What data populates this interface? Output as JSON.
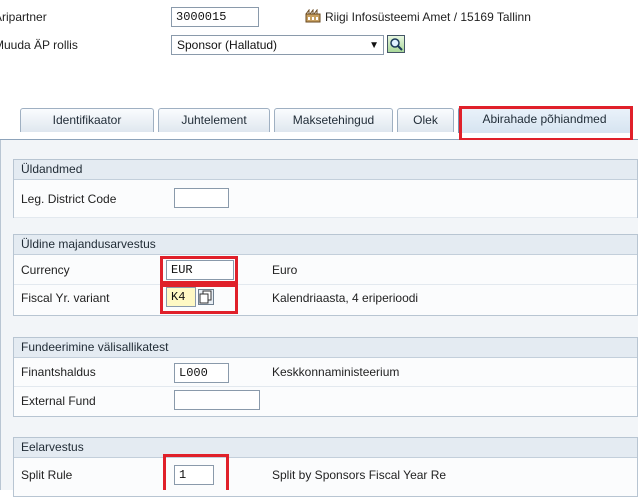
{
  "header": {
    "partner_label": "Äripartner",
    "partner_value": "3000015",
    "partner_description": "Riigi Infosüsteemi Amet / 15169 Tallinn",
    "role_label": "Muuda ÄP rollis",
    "role_value": "Sponsor (Hallatud)"
  },
  "tabs": [
    {
      "label": "Identifikaator"
    },
    {
      "label": "Juhtelement"
    },
    {
      "label": "Maksetehingud"
    },
    {
      "label": "Olek"
    },
    {
      "label": "Abirahade põhiandmed"
    }
  ],
  "sections": {
    "general": {
      "title": "Üldandmed",
      "district_label": "Leg. District Code",
      "district_value": ""
    },
    "finance": {
      "title": "Üldine majandusarvestus",
      "currency_label": "Currency",
      "currency_value": "EUR",
      "currency_text": "Euro",
      "fiscal_label": "Fiscal Yr. variant",
      "fiscal_value": "K4",
      "fiscal_text": "Kalendriaasta, 4 eriperioodi"
    },
    "funding": {
      "title": "Fundeerimine välisallikatest",
      "fin_label": "Finantshaldus",
      "fin_value": "L000",
      "fin_text": "Keskkonnaministeerium",
      "ext_label": "External Fund",
      "ext_value": ""
    },
    "budget": {
      "title": "Eelarvestus",
      "split_label": "Split Rule",
      "split_value": "1",
      "split_text": "Split by Sponsors Fiscal Year Re"
    }
  },
  "colors": {
    "highlight": "#e0202a",
    "accent": "#7f98b3"
  }
}
